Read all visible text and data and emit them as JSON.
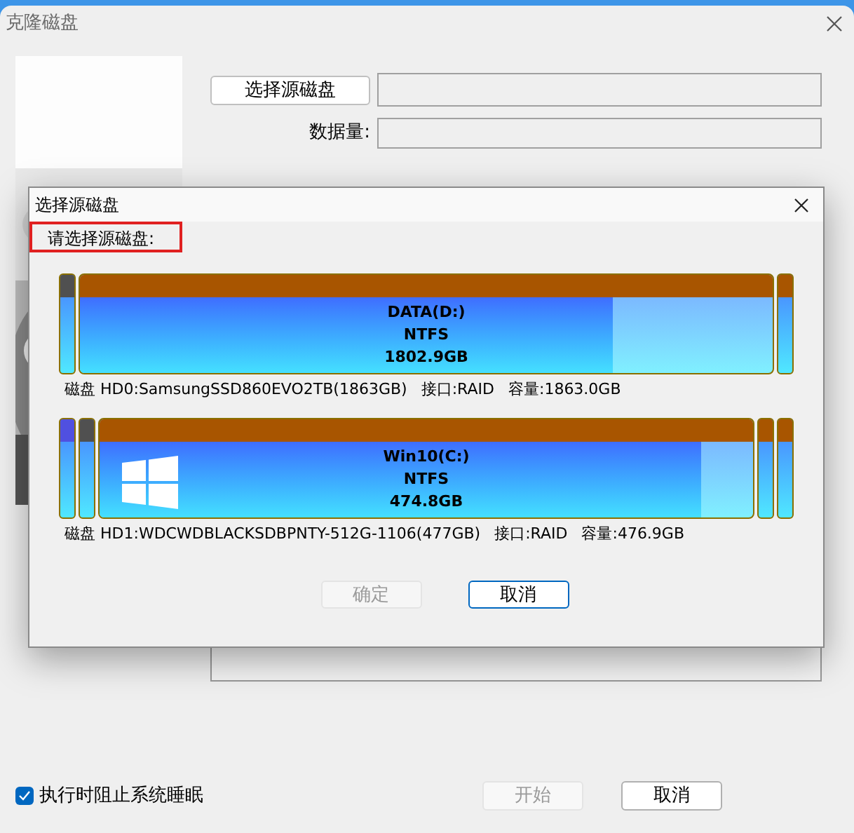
{
  "window": {
    "title": "克隆磁盘"
  },
  "source_button": "选择源磁盘",
  "data_amount": {
    "label": "数据量:"
  },
  "dialog": {
    "title": "选择源磁盘",
    "prompt": "请选择源磁盘:",
    "prompt_highlighted": true,
    "disks": [
      {
        "partitions": [
          {
            "kind": "small",
            "color": "#505050"
          },
          {
            "kind": "volume",
            "color": "#a85500",
            "label": "DATA(D:)",
            "fs": "NTFS",
            "size": "1802.9GB",
            "level": 0.77,
            "os_logo": false
          },
          {
            "kind": "small",
            "color": "#a85500"
          }
        ],
        "name": "磁盘 HD0:SamsungSSD860EVO2TB(1863GB)",
        "interface": "接口:RAID",
        "capacity": "容量:1863.0GB"
      },
      {
        "partitions": [
          {
            "kind": "small",
            "color": "#5050e0"
          },
          {
            "kind": "small",
            "color": "#505050"
          },
          {
            "kind": "volume",
            "color": "#a85500",
            "label": "Win10(C:)",
            "fs": "NTFS",
            "size": "474.8GB",
            "level": 0.92,
            "os_logo": true
          },
          {
            "kind": "small",
            "color": "#a85500"
          },
          {
            "kind": "small",
            "color": "#a85500"
          }
        ],
        "name": "磁盘 HD1:WDCWDBLACKSDBPNTY-512G-1106(477GB)",
        "interface": "接口:RAID",
        "capacity": "容量:476.9GB"
      }
    ],
    "buttons": [
      {
        "label": "确定",
        "disabled": true
      },
      {
        "label": "取消",
        "disabled": false
      }
    ]
  },
  "prevent_sleep": {
    "label": "执行时阻止系统睡眠",
    "checked": true
  },
  "buttons": [
    {
      "label": "开始",
      "disabled": true
    },
    {
      "label": "取消",
      "disabled": false
    }
  ]
}
